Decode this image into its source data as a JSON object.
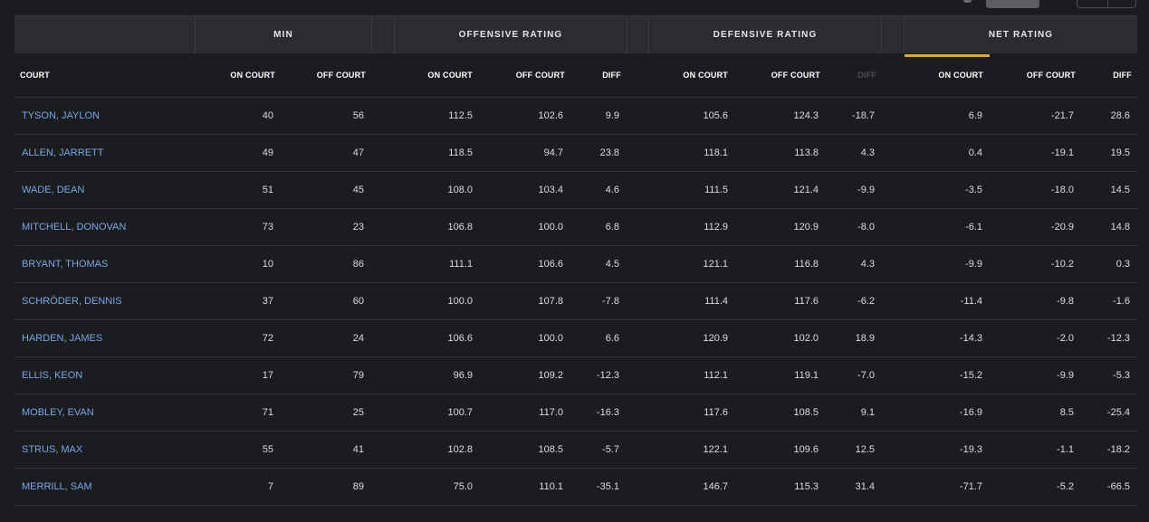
{
  "group_headers": {
    "min": "MIN",
    "offensive": "OFFENSIVE RATING",
    "defensive": "DEFENSIVE RATING",
    "net": "NET RATING"
  },
  "columns": {
    "court": "COURT",
    "min_on": "ON COURT",
    "min_off": "OFF COURT",
    "off_on": "ON COURT",
    "off_off": "OFF COURT",
    "off_diff": "DIFF",
    "def_on": "ON COURT",
    "def_off": "OFF COURT",
    "def_diff": "DIFF",
    "net_on": "ON COURT",
    "net_off": "OFF COURT",
    "net_diff": "DIFF"
  },
  "colors": {
    "accent": "#e4a341",
    "link": "#7ba6e6",
    "background": "#1b1c20",
    "header": "#2a2c31"
  },
  "rows": [
    {
      "name": "TYSON, JAYLON",
      "min_on": "40",
      "min_off": "56",
      "off_on": "112.5",
      "off_off": "102.6",
      "off_diff": "9.9",
      "def_on": "105.6",
      "def_off": "124.3",
      "def_diff": "-18.7",
      "net_on": "6.9",
      "net_off": "-21.7",
      "net_diff": "28.6"
    },
    {
      "name": "ALLEN, JARRETT",
      "min_on": "49",
      "min_off": "47",
      "off_on": "118.5",
      "off_off": "94.7",
      "off_diff": "23.8",
      "def_on": "118.1",
      "def_off": "113.8",
      "def_diff": "4.3",
      "net_on": "0.4",
      "net_off": "-19.1",
      "net_diff": "19.5"
    },
    {
      "name": "WADE, DEAN",
      "min_on": "51",
      "min_off": "45",
      "off_on": "108.0",
      "off_off": "103.4",
      "off_diff": "4.6",
      "def_on": "111.5",
      "def_off": "121.4",
      "def_diff": "-9.9",
      "net_on": "-3.5",
      "net_off": "-18.0",
      "net_diff": "14.5"
    },
    {
      "name": "MITCHELL, DONOVAN",
      "min_on": "73",
      "min_off": "23",
      "off_on": "106.8",
      "off_off": "100.0",
      "off_diff": "6.8",
      "def_on": "112.9",
      "def_off": "120.9",
      "def_diff": "-8.0",
      "net_on": "-6.1",
      "net_off": "-20.9",
      "net_diff": "14.8"
    },
    {
      "name": "BRYANT, THOMAS",
      "min_on": "10",
      "min_off": "86",
      "off_on": "111.1",
      "off_off": "106.6",
      "off_diff": "4.5",
      "def_on": "121.1",
      "def_off": "116.8",
      "def_diff": "4.3",
      "net_on": "-9.9",
      "net_off": "-10.2",
      "net_diff": "0.3"
    },
    {
      "name": "SCHRÖDER, DENNIS",
      "min_on": "37",
      "min_off": "60",
      "off_on": "100.0",
      "off_off": "107.8",
      "off_diff": "-7.8",
      "def_on": "111.4",
      "def_off": "117.6",
      "def_diff": "-6.2",
      "net_on": "-11.4",
      "net_off": "-9.8",
      "net_diff": "-1.6"
    },
    {
      "name": "HARDEN, JAMES",
      "min_on": "72",
      "min_off": "24",
      "off_on": "106.6",
      "off_off": "100.0",
      "off_diff": "6.6",
      "def_on": "120.9",
      "def_off": "102.0",
      "def_diff": "18.9",
      "net_on": "-14.3",
      "net_off": "-2.0",
      "net_diff": "-12.3"
    },
    {
      "name": "ELLIS, KEON",
      "min_on": "17",
      "min_off": "79",
      "off_on": "96.9",
      "off_off": "109.2",
      "off_diff": "-12.3",
      "def_on": "112.1",
      "def_off": "119.1",
      "def_diff": "-7.0",
      "net_on": "-15.2",
      "net_off": "-9.9",
      "net_diff": "-5.3"
    },
    {
      "name": "MOBLEY, EVAN",
      "min_on": "71",
      "min_off": "25",
      "off_on": "100.7",
      "off_off": "117.0",
      "off_diff": "-16.3",
      "def_on": "117.6",
      "def_off": "108.5",
      "def_diff": "9.1",
      "net_on": "-16.9",
      "net_off": "8.5",
      "net_diff": "-25.4"
    },
    {
      "name": "STRUS, MAX",
      "min_on": "55",
      "min_off": "41",
      "off_on": "102.8",
      "off_off": "108.5",
      "off_diff": "-5.7",
      "def_on": "122.1",
      "def_off": "109.6",
      "def_diff": "12.5",
      "net_on": "-19.3",
      "net_off": "-1.1",
      "net_diff": "-18.2"
    },
    {
      "name": "MERRILL, SAM",
      "min_on": "7",
      "min_off": "89",
      "off_on": "75.0",
      "off_off": "110.1",
      "off_diff": "-35.1",
      "def_on": "146.7",
      "def_off": "115.3",
      "def_diff": "31.4",
      "net_on": "-71.7",
      "net_off": "-5.2",
      "net_diff": "-66.5"
    }
  ]
}
